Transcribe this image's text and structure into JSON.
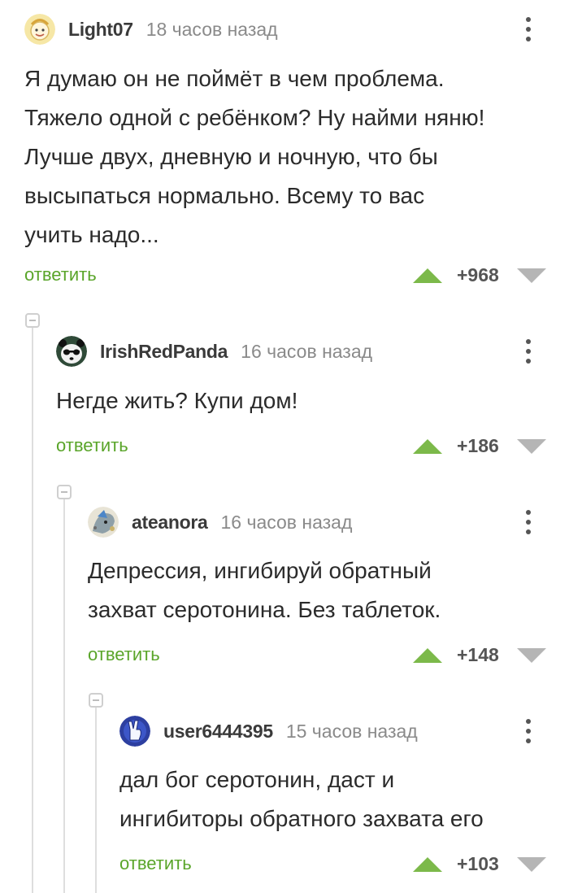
{
  "comments": [
    {
      "username": "Light07",
      "time": "18 часов назад",
      "avatar_icon": "cartoon-face-avatar",
      "text": "Я думаю он не поймёт в чем проблема.\nТяжело одной с ребёнком? Ну найми няню!\nЛучше двух, дневную и ночную, что бы\nвысыпаться нормально. Всему то вас\nучить надо...",
      "reply_label": "ответить",
      "score": "+968"
    },
    {
      "username": "IrishRedPanda",
      "time": "16 часов назад",
      "avatar_icon": "panda-avatar",
      "text": "Негде жить? Купи дом!",
      "reply_label": "ответить",
      "score": "+186"
    },
    {
      "username": "ateanora",
      "time": "16 часов назад",
      "avatar_icon": "character-avatar",
      "text": "Депрессия, ингибируй обратный\nзахват серотонина. Без таблеток.",
      "reply_label": "ответить",
      "score": "+148"
    },
    {
      "username": "user6444395",
      "time": "15 часов назад",
      "avatar_icon": "peace-hand-avatar",
      "text": "дал бог серотонин, даст и\nингибиторы обратного захвата его",
      "reply_label": "ответить",
      "score": "+103"
    }
  ],
  "colors": {
    "reply_link": "#5aa52a",
    "upvote": "#7cb94a",
    "downvote": "#b5b5b5",
    "thread_line": "#dedede"
  }
}
